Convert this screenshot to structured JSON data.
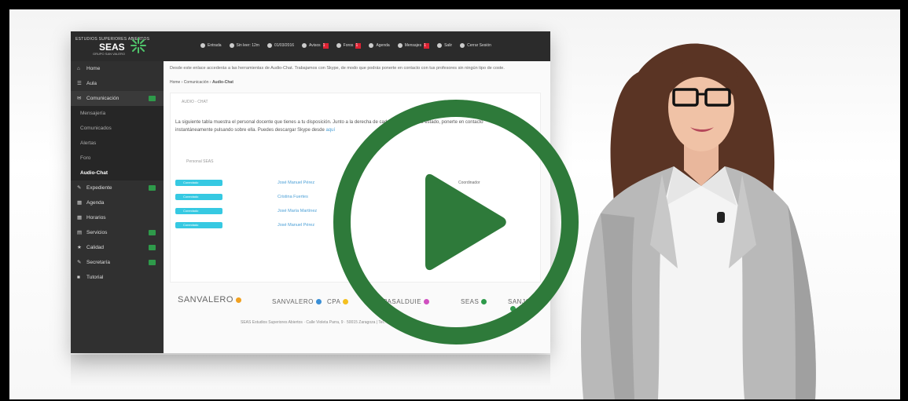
{
  "video": {
    "play_label": "Play"
  },
  "screen": {
    "logo": {
      "top_text": "ESTUDIOS SUPERIORES ABIERTOS",
      "brand": "SEAS",
      "sub_text": "GRUPO SAN VALERO"
    },
    "topmenu": [
      {
        "label": "Entrada",
        "badge": ""
      },
      {
        "label": "Sin leer: 12m",
        "badge": ""
      },
      {
        "label": "01/03/2016",
        "badge": ""
      },
      {
        "label": "Avisos",
        "badge": "1"
      },
      {
        "label": "Foros",
        "badge": "1"
      },
      {
        "label": "Agenda",
        "badge": ""
      },
      {
        "label": "Mensajes",
        "badge": "1"
      },
      {
        "label": "Salir",
        "badge": ""
      },
      {
        "label": "Cerrar Sesión",
        "badge": ""
      }
    ],
    "sidebar": [
      {
        "label": "Home",
        "icon": "⌂",
        "sub": false,
        "active": false,
        "chevron": false
      },
      {
        "label": "Aula",
        "icon": "☰",
        "sub": false,
        "active": false,
        "chevron": false
      },
      {
        "label": "Comunicación",
        "icon": "✉",
        "sub": false,
        "active": false,
        "chevron": true,
        "highlight": true
      },
      {
        "label": "Mensajería",
        "icon": "",
        "sub": true,
        "active": false,
        "chevron": false
      },
      {
        "label": "Comunicados",
        "icon": "",
        "sub": true,
        "active": false,
        "chevron": false
      },
      {
        "label": "Alertas",
        "icon": "",
        "sub": true,
        "active": false,
        "chevron": false
      },
      {
        "label": "Foro",
        "icon": "",
        "sub": true,
        "active": false,
        "chevron": false
      },
      {
        "label": "Audio-Chat",
        "icon": "",
        "sub": true,
        "active": true,
        "chevron": false
      },
      {
        "label": "Expediente",
        "icon": "✎",
        "sub": false,
        "active": false,
        "chevron": true
      },
      {
        "label": "Agenda",
        "icon": "▦",
        "sub": false,
        "active": false,
        "chevron": false
      },
      {
        "label": "Horarios",
        "icon": "▦",
        "sub": false,
        "active": false,
        "chevron": false
      },
      {
        "label": "Servicios",
        "icon": "▤",
        "sub": false,
        "active": false,
        "chevron": true
      },
      {
        "label": "Calidad",
        "icon": "★",
        "sub": false,
        "active": false,
        "chevron": true
      },
      {
        "label": "Secretaría",
        "icon": "✎",
        "sub": false,
        "active": false,
        "chevron": true
      },
      {
        "label": "Tutorial",
        "icon": "■",
        "sub": false,
        "active": false,
        "chevron": false
      }
    ],
    "description": "Desde este enlace accederás a las herramientas de Audio-Chat. Trabajamos con Skype, de modo que podrás ponerte en contacto con tus profesores sin ningún tipo de coste.",
    "breadcrumb": [
      "Home",
      "Comunicación",
      "Audio-Chat"
    ],
    "panel_title": "AUDIO - CHAT",
    "panel_text_before": "La siguiente tabla muestra el personal docente que tienes a tu disposición. Junto a la derecha de cada uno muestra su estado, ponerte en contacto instantáneamente pulsando sobre ella. Puedes descargar Skype desde",
    "panel_text_link": "aquí",
    "section_title": "Personal SEAS",
    "staff": [
      {
        "status": "Conectado",
        "name": "José Manuel Pérez",
        "role": "Coordinador"
      },
      {
        "status": "Conectado",
        "name": "Cristina Fuertes",
        "role": ""
      },
      {
        "status": "Conectado",
        "name": "José María Martínez",
        "role": ""
      },
      {
        "status": "Conectado",
        "name": "José Manuel Pérez",
        "role": ""
      }
    ],
    "footer_logos": [
      {
        "text": "SANVALERO",
        "color": "#f0a020"
      },
      {
        "text": "SANVALERO",
        "color": "#3a8fd6"
      },
      {
        "text": "CPA",
        "color": "#f4c020"
      },
      {
        "text": "CPASALDUIE",
        "color": "#d050c0"
      },
      {
        "text": "SEAS",
        "color": "#2e9a4a"
      },
      {
        "text": "SANJORGE",
        "color": "#2e9a4a"
      }
    ],
    "copyright": "SEAS Estudios Superiores Abiertos · Calle Violeta Parra, 9 · 50015 Zaragoza | Tel.: 976 700 660"
  },
  "colors": {
    "play": "#2e7a3a",
    "sidebar": "#303030",
    "accent_green": "#2e9a4a",
    "status_cyan": "#36c9e2"
  }
}
